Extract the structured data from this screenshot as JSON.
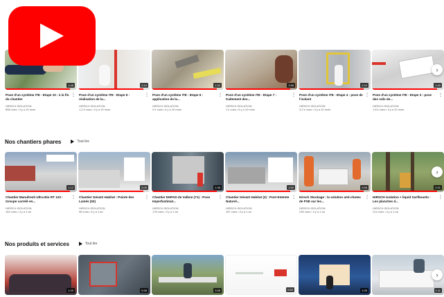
{
  "brand": {
    "logo_color": "#ff0000",
    "logo_icon": "youtube-play-icon"
  },
  "accent": "#ff0000",
  "sections": [
    {
      "title": "",
      "play_all": "",
      "videos": [
        {
          "title": "Pose d'un système ITE - Etape 10 : à la fin du chantier",
          "channel": "HIRSCH ISOLATION",
          "stats": "858 vues • il y a 10 mois",
          "duration": "1:45",
          "progress": 0.9
        },
        {
          "title": "Pose d'un système ITE - Etape 8 : réalisation de la...",
          "channel": "HIRSCH ISOLATION",
          "stats": "1,2 k vues • il y a 10 mois",
          "duration": "2:10",
          "progress": 0.9
        },
        {
          "title": "Pose d'un système ITE - Etape 6 : application de la...",
          "channel": "HIRSCH ISOLATION",
          "stats": "2 k vues • il y a 10 mois",
          "duration": "1:32",
          "progress": 0.9
        },
        {
          "title": "Pose d'un système ITE - Etape 7 : traitement des...",
          "channel": "HIRSCH ISOLATION",
          "stats": "1 k vues • il y a 10 mois",
          "duration": "1:58",
          "progress": 0.9
        },
        {
          "title": "Pose d'un système ITE - Etape 4 : pose de l'isolant",
          "channel": "HIRSCH ISOLATION",
          "stats": "3,2 k vues • il y a 10 mois",
          "duration": "2:24",
          "progress": 0.9
        },
        {
          "title": "Pose d'un système ITE - Etape 3 : pose des rails de...",
          "channel": "HIRSCH ISOLATION",
          "stats": "1,8 k vues • il y a 10 mois",
          "duration": "1:40",
          "progress": 0.9
        }
      ]
    },
    {
      "title": "Nos chantiers phares",
      "play_all": "Tout lire",
      "videos": [
        {
          "title": "Chantier Manufresh Ultra Bio RT 120 : Groupe carrelé en...",
          "channel": "HIRSCH ISOLATION",
          "stats": "162 vues • il y a 1 an",
          "duration": "1:12",
          "progress": 0.9
        },
        {
          "title": "Chantier Géo&S Habitat : Pointe des Lainés (53)",
          "channel": "HIRSCH ISOLATION",
          "stats": "98 vues • il y a 1 an",
          "duration": "2:05",
          "progress": 0.9
        },
        {
          "title": "Chantier EHPAD de Valbon (71) : Pose Imperfastimat...",
          "channel": "HIRSCH ISOLATION",
          "stats": "178 vues • il y a 1 an",
          "duration": "1:38",
          "progress": 0.9
        },
        {
          "title": "Chantier Géo&S Habitat (2) : Pont Entente Naturel...",
          "channel": "HIRSCH ISOLATION",
          "stats": "187 vues • il y a 1 an",
          "duration": "1:50",
          "progress": 0.9
        },
        {
          "title": "Hirsch Stockage : la solution anti-chutes de PSE sur les...",
          "channel": "HIRSCH ISOLATION",
          "stats": "235 vues • il y a 1 an",
          "duration": "0:58",
          "progress": 0.9
        },
        {
          "title": "HIRSCH isolation + liquid Surfboards : Les planches d...",
          "channel": "HIRSCH ISOLATION",
          "stats": "214 vues • il y a 1 an",
          "duration": "2:31",
          "progress": 0.9
        }
      ]
    },
    {
      "title": "Nos produits et services",
      "play_all": "Tout lire",
      "videos": [
        {
          "title": "",
          "channel": "",
          "stats": "",
          "duration": "1:20",
          "progress": 0
        },
        {
          "title": "",
          "channel": "",
          "stats": "",
          "duration": "0:45",
          "progress": 0
        },
        {
          "title": "",
          "channel": "",
          "stats": "",
          "duration": "1:05",
          "progress": 0
        },
        {
          "title": "",
          "channel": "",
          "stats": "",
          "duration": "0:52",
          "progress": 0
        },
        {
          "title": "",
          "channel": "",
          "stats": "",
          "duration": "1:33",
          "progress": 0
        },
        {
          "title": "",
          "channel": "",
          "stats": "",
          "duration": "1:11",
          "progress": 0
        }
      ]
    }
  ],
  "next_button_icon": "chevron-right-icon"
}
